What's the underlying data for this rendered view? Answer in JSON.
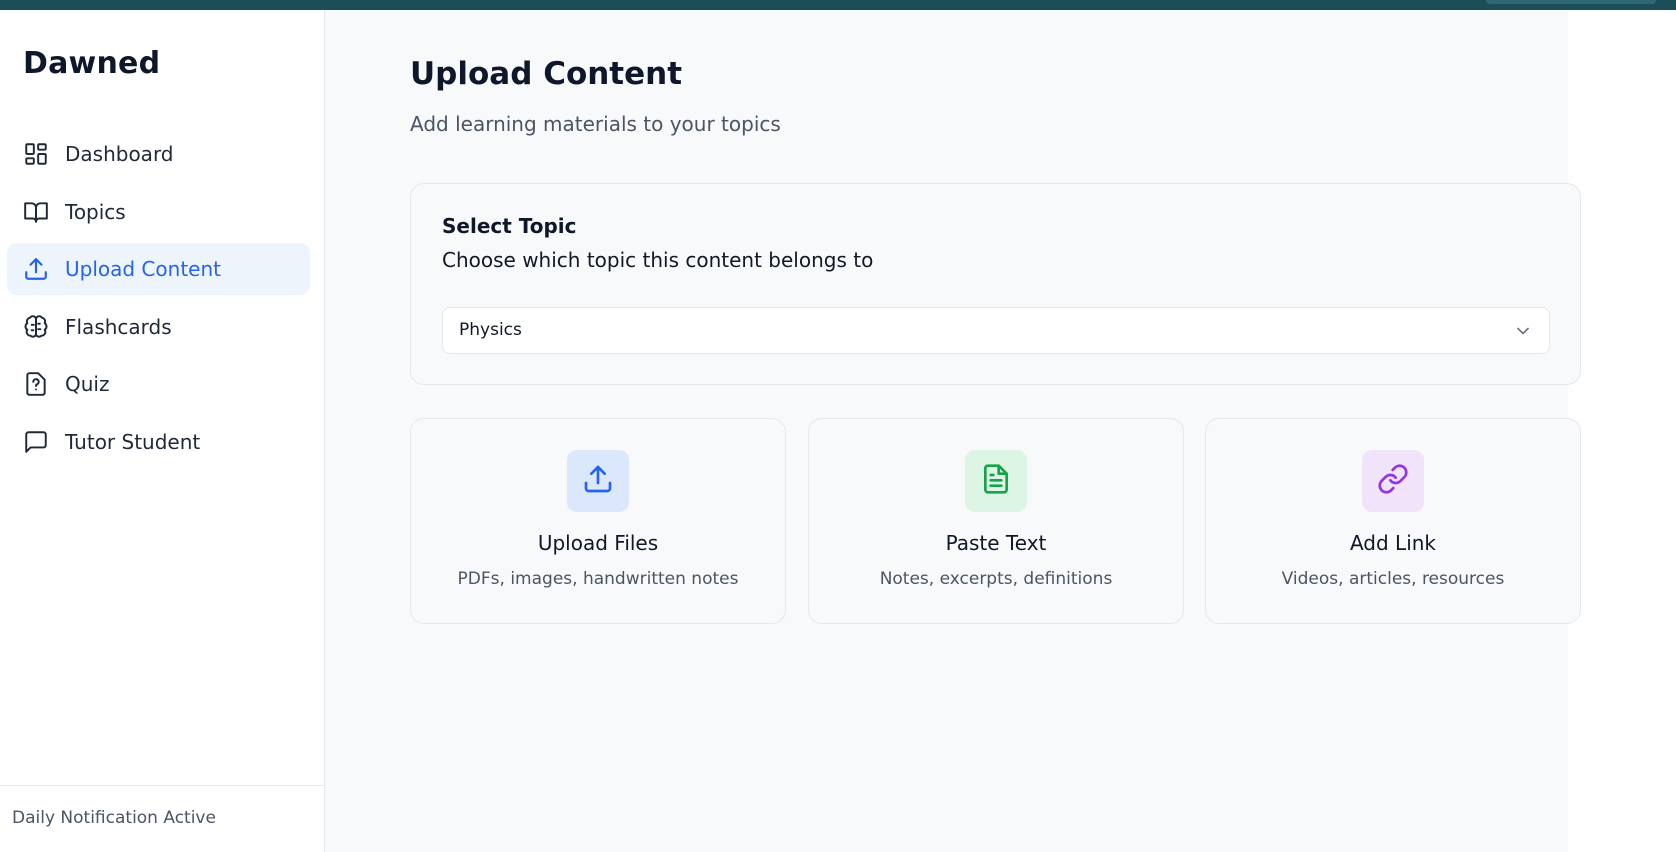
{
  "app": {
    "brand": "Dawned"
  },
  "sidebar": {
    "items": [
      {
        "label": "Dashboard",
        "icon": "grid-icon",
        "active": false
      },
      {
        "label": "Topics",
        "icon": "book-open-icon",
        "active": false
      },
      {
        "label": "Upload Content",
        "icon": "upload-icon",
        "active": true
      },
      {
        "label": "Flashcards",
        "icon": "brain-icon",
        "active": false
      },
      {
        "label": "Quiz",
        "icon": "help-file-icon",
        "active": false
      },
      {
        "label": "Tutor Student",
        "icon": "message-square-icon",
        "active": false
      }
    ],
    "footer": "Daily Notification Active"
  },
  "page": {
    "title": "Upload Content",
    "subtitle": "Add learning materials to your topics"
  },
  "topic_select": {
    "title": "Select Topic",
    "description": "Choose which topic this content belongs to",
    "selected": "Physics"
  },
  "options": [
    {
      "title": "Upload Files",
      "description": "PDFs, images, handwritten notes",
      "icon": "upload-icon",
      "tile_color": "#dbe8fb",
      "icon_color": "#2563eb"
    },
    {
      "title": "Paste Text",
      "description": "Notes, excerpts, definitions",
      "icon": "file-text-icon",
      "tile_color": "#dcf5e4",
      "icon_color": "#16a34a"
    },
    {
      "title": "Add Link",
      "description": "Videos, articles, resources",
      "icon": "link-icon",
      "tile_color": "#f1e4fa",
      "icon_color": "#9333ea"
    }
  ],
  "colors": {
    "accent": "#2563eb",
    "active_bg": "#eef4fc",
    "topbar": "#1d4e57"
  }
}
